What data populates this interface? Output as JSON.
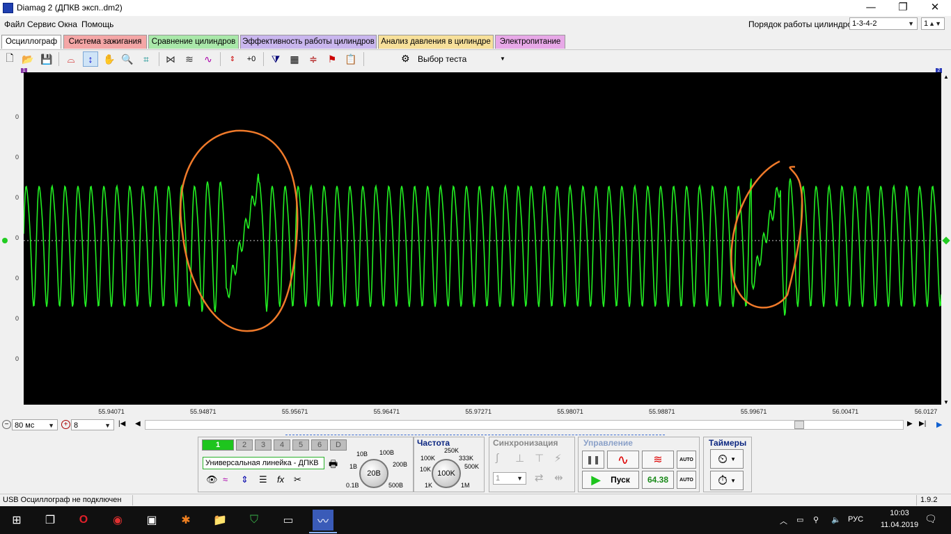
{
  "window": {
    "title": "Diamag 2 (ДПКВ эксп..dm2)",
    "controls": [
      "—",
      "❐",
      "✕"
    ]
  },
  "menu": {
    "items": [
      "Файл",
      "Сервис",
      "Окна",
      "Помощь"
    ],
    "cyl_order_label": "Порядок работы цилиндров",
    "cyl_order_value": "1-3-4-2",
    "cyl_num_value": "1"
  },
  "tabs": [
    {
      "label": "Осциллограф",
      "color": "#ffffff"
    },
    {
      "label": "Система зажигания",
      "color": "#f4a6a6"
    },
    {
      "label": "Сравнение цилиндров",
      "color": "#a9e8a9"
    },
    {
      "label": "Эффективность работы цилиндров",
      "color": "#c9b6ee"
    },
    {
      "label": "Анализ давления в цилиндре",
      "color": "#f7e09a"
    },
    {
      "label": "Электропитание",
      "color": "#e7a8e7"
    }
  ],
  "toolbar": {
    "test_select_label": "Выбор теста"
  },
  "scope": {
    "channel_label": "1 Универсальная линейка - ДПКВ (В)",
    "y_ticks": [
      "0",
      "0",
      "0",
      "0",
      "0",
      "0",
      "0"
    ],
    "x_ticks": [
      "55.94071",
      "55.94871",
      "55.95671",
      "55.96471",
      "55.97271",
      "55.98071",
      "55.98871",
      "55.99671",
      "56.00471",
      "56.0127"
    ],
    "signal_color": "#22ee22",
    "annotation_color": "#f07a2a",
    "markers": [
      "1",
      "2"
    ]
  },
  "timebase": {
    "value": "80 мс",
    "count": "8"
  },
  "channels": {
    "buttons": [
      "1",
      "2",
      "3",
      "4",
      "5",
      "6",
      "D"
    ],
    "source": "Универсальная линейка - ДПКВ",
    "range_center": "20В",
    "range_ticks": [
      "10В",
      "100В",
      "1В",
      "200В",
      "0.1В",
      "500В"
    ]
  },
  "frequency": {
    "title": "Частота",
    "center": "100K",
    "ticks": [
      "250K",
      "100K",
      "333K",
      "10K",
      "500K",
      "1K",
      "1M"
    ]
  },
  "sync": {
    "title": "Синхронизация",
    "channel_value": "1"
  },
  "control": {
    "title": "Управление",
    "start_label": "Пуск",
    "value": "64.38",
    "auto_label": "AUTO"
  },
  "timers": {
    "title": "Таймеры"
  },
  "status": {
    "text": "USB Осциллограф не подключен",
    "version": "1.9.2"
  },
  "taskbar": {
    "lang": "РУС",
    "time": "10:03",
    "date": "11.04.2019"
  }
}
